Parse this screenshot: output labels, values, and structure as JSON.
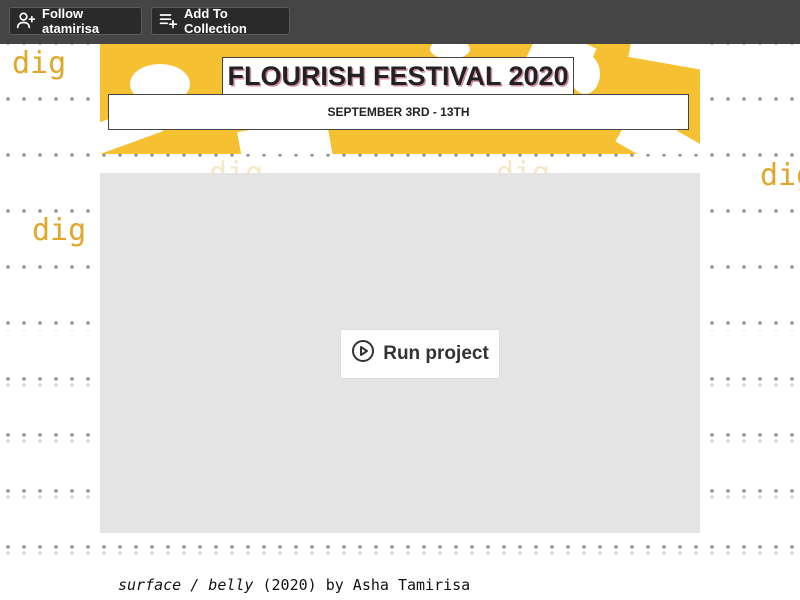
{
  "toolbar": {
    "follow_label": "Follow atamirisa",
    "collection_label": "Add To Collection"
  },
  "background": {
    "word": "dig"
  },
  "banner": {
    "title": "FLOURISH FESTIVAL 2020",
    "dates": "SEPTEMBER 3RD - 13TH"
  },
  "player": {
    "run_label": "Run project"
  },
  "caption": {
    "title": "surface / belly",
    "meta": " (2020) by Asha Tamirisa"
  },
  "colors": {
    "toolbar_bg": "#454545",
    "accent_yellow": "#f6c033",
    "dig_text": "#e0a728",
    "player_bg": "#e3e4e3"
  }
}
